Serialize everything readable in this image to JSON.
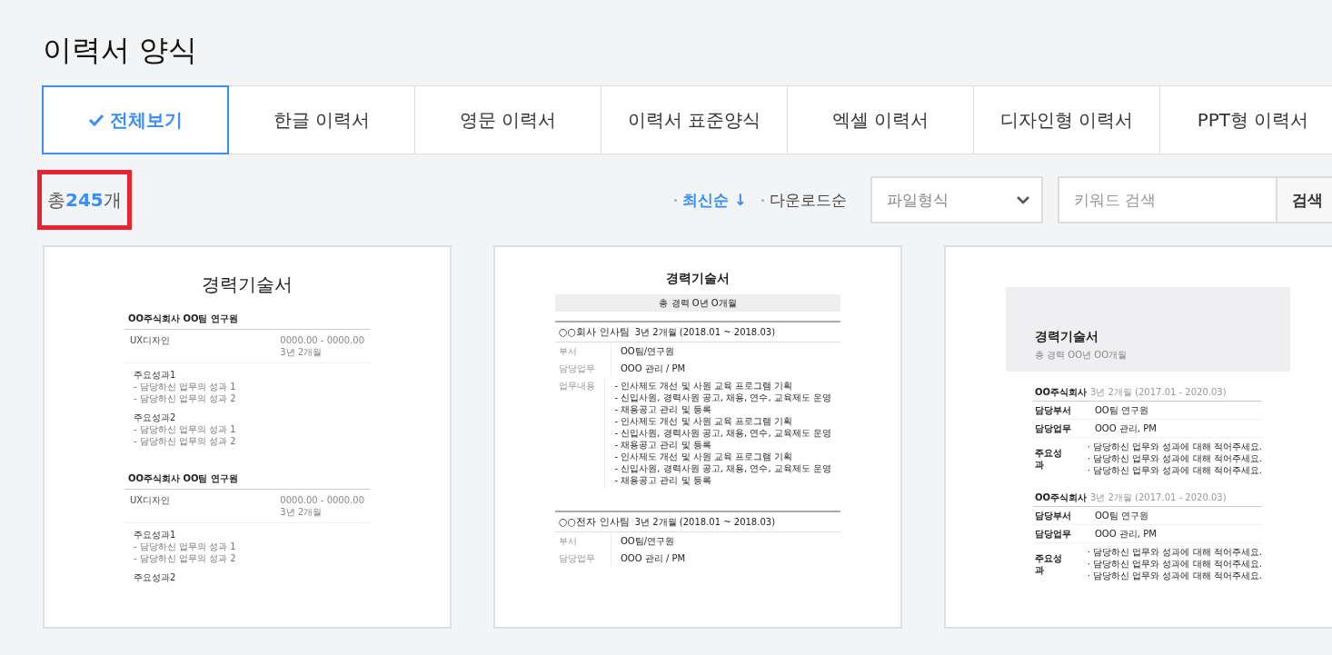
{
  "title": "이력서 양식",
  "tabs": [
    {
      "label": "전체보기",
      "selected": true
    },
    {
      "label": "한글 이력서",
      "selected": false
    },
    {
      "label": "영문 이력서",
      "selected": false
    },
    {
      "label": "이력서 표준양식",
      "selected": false
    },
    {
      "label": "엑셀 이력서",
      "selected": false
    },
    {
      "label": "디자인형 이력서",
      "selected": false
    },
    {
      "label": "PPT형 이력서",
      "selected": false
    }
  ],
  "count": {
    "prefix": "총",
    "number": "245",
    "suffix": "개",
    "highlighted": true
  },
  "sort_options": [
    {
      "label": "최신순",
      "arrow": "↓",
      "selected": true
    },
    {
      "label": "다운로드순",
      "selected": false
    }
  ],
  "file_type_select": {
    "label": "파일형식"
  },
  "search": {
    "placeholder": "키워드 검색",
    "button": "검색"
  },
  "templates": [
    {
      "kind": "plain",
      "title": "경력기술서",
      "sections": [
        {
          "heading": "OO주식회사 OO팀 연구원",
          "role": "UX디자인",
          "period": "0000.00 - 0000.00",
          "duration": "3년 2개월",
          "groups": [
            {
              "title": "주요성과1",
              "items": [
                "-   담당하신 업무의 성과 1",
                "-   담당하신 업무의 성과 2"
              ]
            },
            {
              "title": "주요성과2",
              "items": [
                "-   담당하신 업무의 성과 1",
                "-   담당하신 업무의 성과 2"
              ]
            }
          ]
        },
        {
          "heading": "OO주식회사 OO팀 연구원",
          "role": "UX디자인",
          "period": "0000.00 - 0000.00",
          "duration": "3년 2개월",
          "groups": [
            {
              "title": "주요성과1",
              "items": [
                "-   담당하신 업무의 성과 1",
                "-   담당하신 업무의 성과 2"
              ]
            },
            {
              "title": "주요성과2"
            }
          ]
        }
      ]
    },
    {
      "kind": "table",
      "title": "경력기술서",
      "total": "총 경력 O년 O개월",
      "companies": [
        {
          "name": "○○회사 인사팀",
          "duration": "3년 2개월",
          "period": "(2018.01 ~ 2018.03)",
          "rows": [
            {
              "label": "부서",
              "value": "OO팀/연구원"
            },
            {
              "label": "담당업무",
              "value": "OOO 관리 / PM"
            },
            {
              "label": "업무내용",
              "items": [
                "- 인사제도 개선 및 사원 교육 프로그램 기획",
                "- 신입사원, 경력사원 공고, 채용, 연수, 교육제도 운영",
                "- 채용공고 관리 및 등록",
                "- 인사제도 개선 및 사원 교육 프로그램 기획",
                "- 신입사원, 경력사원 공고, 채용, 연수, 교육제도 운영",
                "- 채용공고 관리 및 등록",
                "- 인사제도 개선 및 사원 교육 프로그램 기획",
                "- 신입사원, 경력사원 공고, 채용, 연수, 교육제도 운영",
                "- 채용공고 관리 및 등록"
              ]
            }
          ]
        },
        {
          "name": "○○전자 인사팀",
          "duration": "3년 2개월",
          "period": "(2018.01 ~ 2018.03)",
          "rows": [
            {
              "label": "부서",
              "value": "OO팀/연구원"
            },
            {
              "label": "담당업무",
              "value": "OOO 관리 / PM"
            }
          ]
        }
      ]
    },
    {
      "kind": "banner",
      "title": "경력기술서",
      "subtitle": "총 경력 OO년 OO개월",
      "companies": [
        {
          "name": "OO주식회사",
          "duration": "3년 2개월",
          "period": "(2017.01 - 2020.03)",
          "rows": [
            {
              "label": "담당부서",
              "value": "OO팀 연구원"
            },
            {
              "label": "담당업무",
              "value": "OOO 관리, PM"
            },
            {
              "label": "주요성과",
              "items": [
                "· 담당하신 업무와 성과에 대해 적어주세요.",
                "· 담당하신 업무와 성과에 대해 적어주세요.",
                "· 담당하신 업무와 성과에 대해 적어주세요."
              ]
            }
          ]
        },
        {
          "name": "OO주식회사",
          "duration": "3년 2개월",
          "period": "(2017.01 - 2020.03)",
          "rows": [
            {
              "label": "담당부서",
              "value": "OO팀 연구원"
            },
            {
              "label": "담당업무",
              "value": "OOO 관리, PM"
            },
            {
              "label": "주요성과",
              "items": [
                "· 담당하신 업무와 성과에 대해 적어주세요.",
                "· 담당하신 업무와 성과에 대해 적어주세요.",
                "· 담당하신 업무와 성과에 대해 적어주세요."
              ]
            }
          ]
        }
      ]
    }
  ]
}
